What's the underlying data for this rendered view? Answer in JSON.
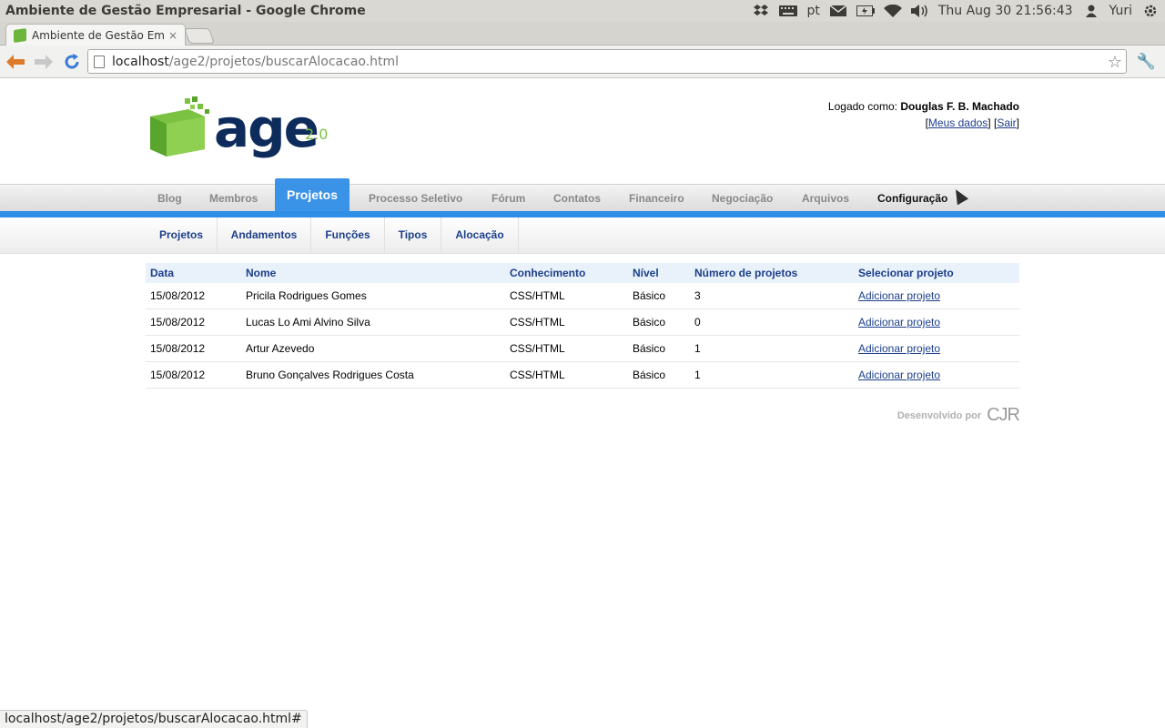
{
  "window_title": "Ambiente de Gestão Empresarial - Google Chrome",
  "tray": {
    "lang": "pt",
    "datetime": "Thu Aug 30 21:56:43",
    "user": "Yuri"
  },
  "tab": {
    "label": "Ambiente de Gestão Empr",
    "close": "×"
  },
  "address": {
    "host": "localhost",
    "path": "/age2/projetos/buscarAlocacao.html"
  },
  "logo": {
    "text": "age",
    "version": "2.0"
  },
  "user_box": {
    "logged_label": "Logado como: ",
    "user_name": "Douglas F. B. Machado",
    "meus_dados": "Meus dados",
    "sair": "Sair"
  },
  "mainnav": {
    "items": [
      "Blog",
      "Membros",
      "Projetos",
      "Processo Seletivo",
      "Fórum",
      "Contatos",
      "Financeiro",
      "Negociação",
      "Arquivos",
      "Configuração"
    ]
  },
  "subnav": {
    "items": [
      "Projetos",
      "Andamentos",
      "Funções",
      "Tipos",
      "Alocação"
    ]
  },
  "table": {
    "headers": [
      "Data",
      "Nome",
      "Conhecimento",
      "Nível",
      "Número de projetos",
      "Selecionar projeto"
    ],
    "rows": [
      [
        "15/08/2012",
        "Pricila Rodrigues Gomes",
        "CSS/HTML",
        "Básico",
        "3",
        "Adicionar projeto"
      ],
      [
        "15/08/2012",
        "Lucas Lo Ami Alvino Silva",
        "CSS/HTML",
        "Básico",
        "0",
        "Adicionar projeto"
      ],
      [
        "15/08/2012",
        "Artur Azevedo",
        "CSS/HTML",
        "Básico",
        "1",
        "Adicionar projeto"
      ],
      [
        "15/08/2012",
        "Bruno Gonçalves Rodrigues Costa",
        "CSS/HTML",
        "Básico",
        "1",
        "Adicionar projeto"
      ]
    ]
  },
  "footer": {
    "label": "Desenvolvido por",
    "brand": "CJR"
  },
  "status_url": "localhost/age2/projetos/buscarAlocacao.html#",
  "colors": {
    "accent_blue": "#2f8fe6",
    "logo_green": "#7cc242",
    "logo_navy": "#0d2c5b",
    "link": "#1c3f8a"
  }
}
